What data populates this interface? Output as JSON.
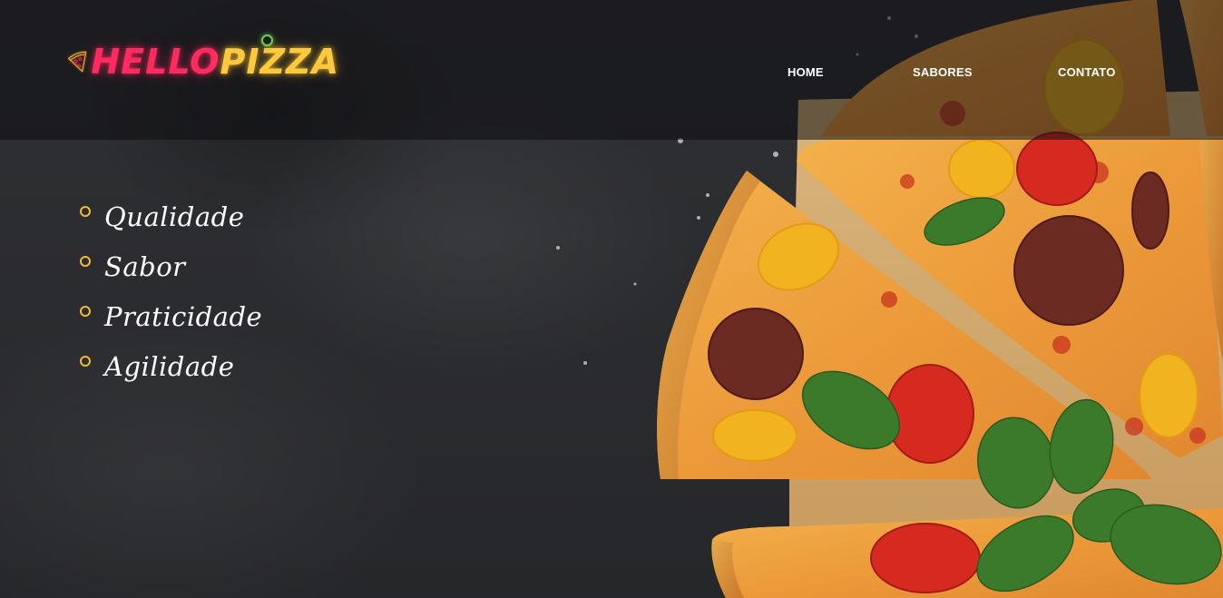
{
  "brand": {
    "logo_icon": "pizza-slice-icon",
    "name_part1": "HELLO",
    "name_part2": "PIZZA",
    "colors": {
      "hello": "#ff2a5f",
      "pizza": "#ffc93c",
      "dot": "#6fd14a"
    }
  },
  "nav": {
    "items": [
      {
        "label": "HOME"
      },
      {
        "label": "SABORES"
      },
      {
        "label": "CONTATO"
      }
    ]
  },
  "features": {
    "bullet_color": "#f5b83a",
    "items": [
      {
        "label": "Qualidade"
      },
      {
        "label": "Sabor"
      },
      {
        "label": "Praticidade"
      },
      {
        "label": "Agilidade"
      }
    ]
  },
  "hero_image": "pizza-slices-photo"
}
